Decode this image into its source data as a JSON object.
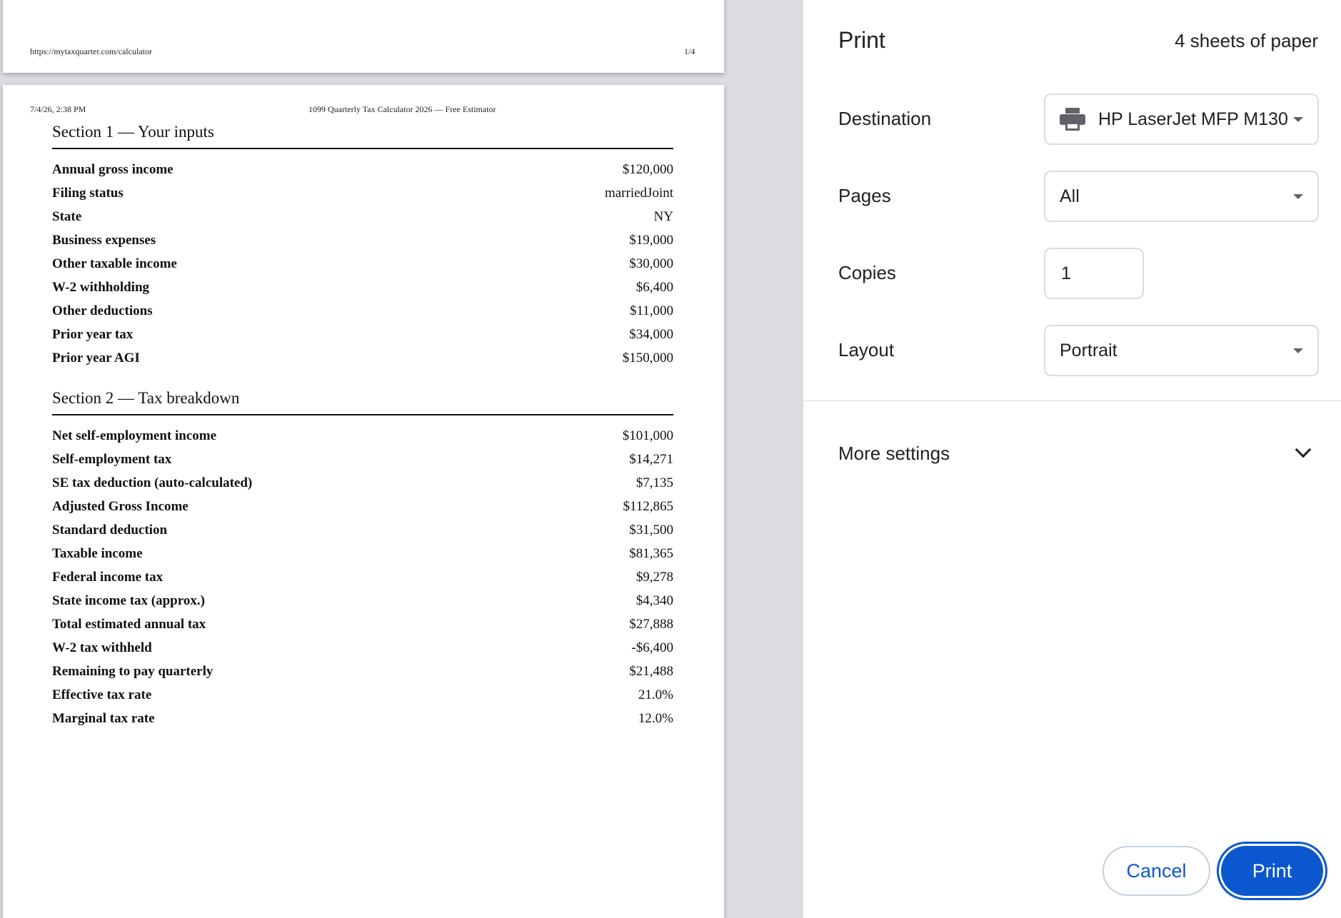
{
  "preview": {
    "prev_page": {
      "footer_url": "https://mytaxquarter.com/calculator",
      "footer_page": "1/4"
    },
    "current_page": {
      "header_date": "7/4/26, 2:38 PM",
      "header_title": "1099 Quarterly Tax Calculator 2026 — Free Estimator",
      "section1": {
        "title": "Section 1 — Your inputs",
        "rows": [
          {
            "label": "Annual gross income",
            "value": "$120,000"
          },
          {
            "label": "Filing status",
            "value": "marriedJoint"
          },
          {
            "label": "State",
            "value": "NY"
          },
          {
            "label": "Business expenses",
            "value": "$19,000"
          },
          {
            "label": "Other taxable income",
            "value": "$30,000"
          },
          {
            "label": "W-2 withholding",
            "value": "$6,400"
          },
          {
            "label": "Other deductions",
            "value": "$11,000"
          },
          {
            "label": "Prior year tax",
            "value": "$34,000"
          },
          {
            "label": "Prior year AGI",
            "value": "$150,000"
          }
        ]
      },
      "section2": {
        "title": "Section 2 — Tax breakdown",
        "rows": [
          {
            "label": "Net self-employment income",
            "value": "$101,000"
          },
          {
            "label": "Self-employment tax",
            "value": "$14,271"
          },
          {
            "label": "SE tax deduction (auto-calculated)",
            "value": "$7,135"
          },
          {
            "label": "Adjusted Gross Income",
            "value": "$112,865"
          },
          {
            "label": "Standard deduction",
            "value": "$31,500"
          },
          {
            "label": "Taxable income",
            "value": "$81,365"
          },
          {
            "label": "Federal income tax",
            "value": "$9,278"
          },
          {
            "label": "State income tax (approx.)",
            "value": "$4,340"
          },
          {
            "label": "Total estimated annual tax",
            "value": "$27,888"
          },
          {
            "label": "W-2 tax withheld",
            "value": "-$6,400"
          },
          {
            "label": "Remaining to pay quarterly",
            "value": "$21,488"
          },
          {
            "label": "Effective tax rate",
            "value": "21.0%"
          },
          {
            "label": "Marginal tax rate",
            "value": "12.0%"
          }
        ]
      }
    }
  },
  "panel": {
    "title": "Print",
    "sheets_count": "4 sheets of paper",
    "destination": {
      "label": "Destination",
      "value": "HP LaserJet MFP M130",
      "icon": "printer-icon"
    },
    "pages": {
      "label": "Pages",
      "value": "All"
    },
    "copies": {
      "label": "Copies",
      "value": "1"
    },
    "layout": {
      "label": "Layout",
      "value": "Portrait"
    },
    "more_settings": {
      "label": "More settings",
      "icon": "chevron-down-icon"
    },
    "cancel_label": "Cancel",
    "print_label": "Print"
  },
  "colors": {
    "accent": "#0b57d0",
    "preview_background": "#dadce0",
    "border": "#dadce0"
  }
}
